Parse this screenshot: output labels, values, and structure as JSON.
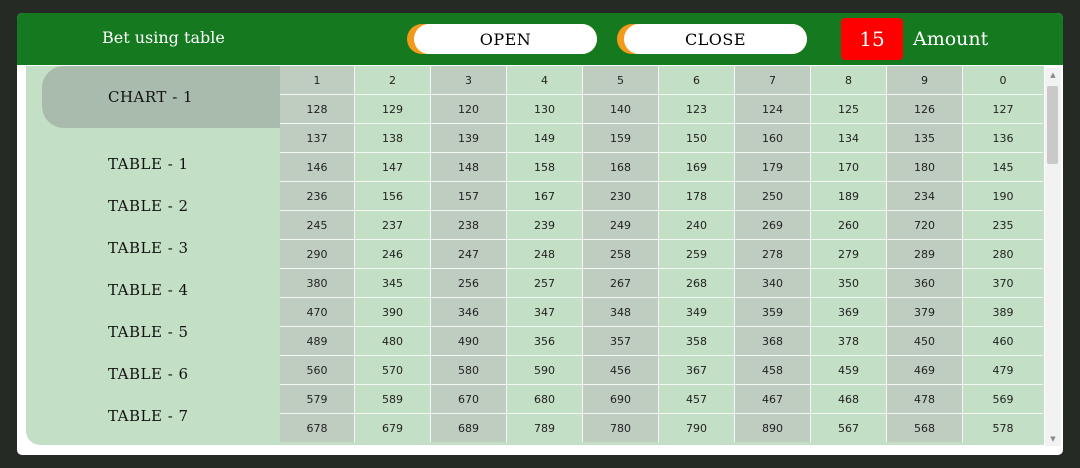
{
  "header": {
    "title": "Bet using table",
    "open_label": "OPEN",
    "close_label": "CLOSE",
    "amount_value": "15",
    "amount_label": "Amount"
  },
  "sidebar": {
    "items": [
      "CHART - 1",
      "TABLE - 1",
      "TABLE - 2",
      "TABLE - 3",
      "TABLE - 4",
      "TABLE - 5",
      "TABLE - 6",
      "TABLE - 7"
    ]
  },
  "table": {
    "headers": [
      "1",
      "2",
      "3",
      "4",
      "5",
      "6",
      "7",
      "8",
      "9",
      "0"
    ],
    "rows": [
      [
        "128",
        "129",
        "120",
        "130",
        "140",
        "123",
        "124",
        "125",
        "126",
        "127"
      ],
      [
        "137",
        "138",
        "139",
        "149",
        "159",
        "150",
        "160",
        "134",
        "135",
        "136"
      ],
      [
        "146",
        "147",
        "148",
        "158",
        "168",
        "169",
        "179",
        "170",
        "180",
        "145"
      ],
      [
        "236",
        "156",
        "157",
        "167",
        "230",
        "178",
        "250",
        "189",
        "234",
        "190"
      ],
      [
        "245",
        "237",
        "238",
        "239",
        "249",
        "240",
        "269",
        "260",
        "720",
        "235"
      ],
      [
        "290",
        "246",
        "247",
        "248",
        "258",
        "259",
        "278",
        "279",
        "289",
        "280"
      ],
      [
        "380",
        "345",
        "256",
        "257",
        "267",
        "268",
        "340",
        "350",
        "360",
        "370"
      ],
      [
        "470",
        "390",
        "346",
        "347",
        "348",
        "349",
        "359",
        "369",
        "379",
        "389"
      ],
      [
        "489",
        "480",
        "490",
        "356",
        "357",
        "358",
        "368",
        "378",
        "450",
        "460"
      ],
      [
        "560",
        "570",
        "580",
        "590",
        "456",
        "367",
        "458",
        "459",
        "469",
        "479"
      ],
      [
        "579",
        "589",
        "670",
        "680",
        "690",
        "457",
        "467",
        "468",
        "478",
        "569"
      ],
      [
        "678",
        "679",
        "689",
        "789",
        "780",
        "790",
        "890",
        "567",
        "568",
        "578"
      ]
    ]
  },
  "colors": {
    "header_bg": "#157a1f",
    "body_bg": "#c3dfc5",
    "cell_shade": "#bfcdc1",
    "amount_badge": "#ff0000",
    "pill_accent": "#f39a1a"
  }
}
